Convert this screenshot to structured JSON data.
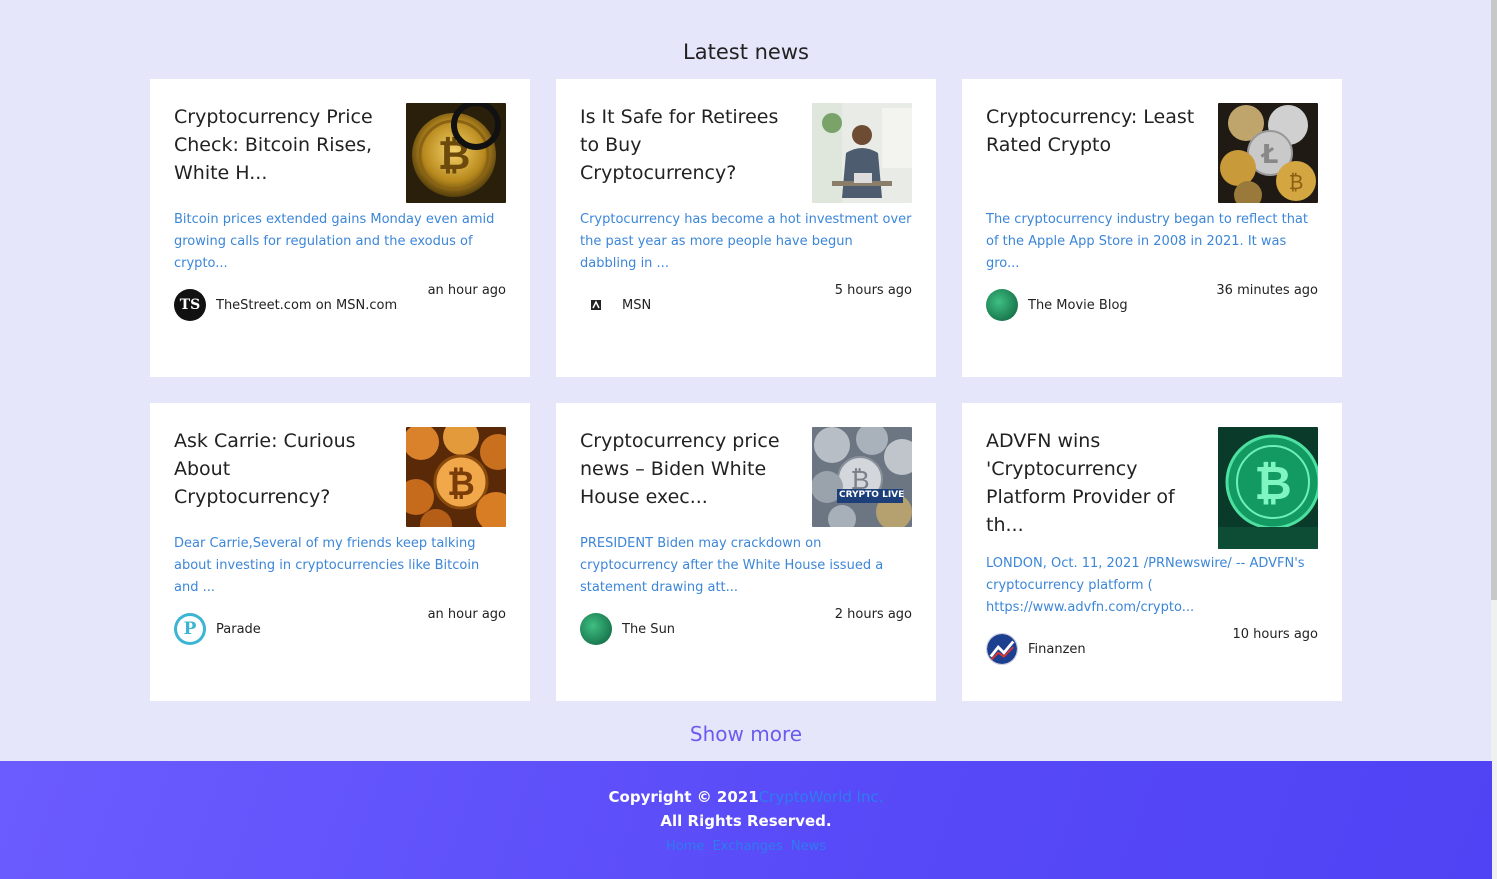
{
  "heading": "Latest news",
  "cards": [
    {
      "title": "Cryptocurrency Price Check: Bitcoin Rises, White H...",
      "desc": "Bitcoin prices extended gains Monday even amid growing calls for regulation and the exodus of crypto...",
      "provider": "TheStreet.com on MSN.com",
      "time": "an hour ago"
    },
    {
      "title": "Is It Safe for Retirees to Buy Cryptocurrency?",
      "desc": "Cryptocurrency has become a hot investment over the past year as more people have begun dabbling in ...",
      "provider": "MSN",
      "time": "5 hours ago"
    },
    {
      "title": "Cryptocurrency: Least Rated Crypto",
      "desc": "The cryptocurrency industry began to reflect that of the Apple App Store in 2008 in 2021. It was gro...",
      "provider": "The Movie Blog",
      "time": "36 minutes ago"
    },
    {
      "title": "Ask Carrie: Curious About Cryptocurrency?",
      "desc": "Dear Carrie,Several of my friends keep talking about investing in cryptocurrencies like Bitcoin and ...",
      "provider": "Parade",
      "time": "an hour ago"
    },
    {
      "title": "Cryptocurrency price news – Biden White House exec...",
      "desc": "PRESIDENT Biden may crackdown on cryptocurrency after the White House issued a statement drawing att...",
      "provider": "The Sun",
      "time": "2 hours ago",
      "thumb_text": "CRYPTO LIVE"
    },
    {
      "title": "ADVFN wins 'Cryptocurrency Platform Provider of th...",
      "desc": "LONDON, Oct. 11, 2021 /PRNewswire/ -- ADVFN's cryptocurrency platform ( https://www.advfn.com/crypto...",
      "provider": "Finanzen",
      "time": "10 hours ago"
    }
  ],
  "avatars": {
    "thestreet": "TS",
    "parade": "P"
  },
  "show_more": "Show more",
  "footer": {
    "copyright": "Copyright © 2021",
    "brand": "CryptoWorld Inc.",
    "rights": "All Rights Reserved.",
    "links": [
      "Home",
      "Exchanges",
      "News"
    ]
  },
  "colors": {
    "background": "#e6e6fa",
    "link": "#3c86d8",
    "accent": "#6a5bf0",
    "footer": "#5749f7"
  }
}
